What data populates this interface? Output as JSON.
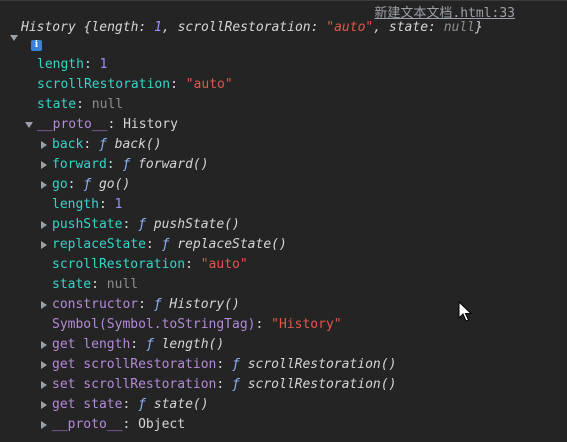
{
  "source_link": "新建文本文档.html:33",
  "header": {
    "class_name": "History",
    "open": "{",
    "k1": "length",
    "v1": "1",
    "k2": "scrollRestoration",
    "v2": "\"auto\"",
    "k3": "state",
    "v3": "null",
    "close": "}"
  },
  "info_icon_glyph": "i",
  "rows": [
    {
      "key": "length",
      "sep": ": ",
      "value": "1",
      "vtype": "num"
    },
    {
      "key": "scrollRestoration",
      "sep": ": ",
      "value": "\"auto\"",
      "vtype": "str"
    },
    {
      "key": "state",
      "sep": ": ",
      "value": "null",
      "vtype": "null"
    },
    {
      "key": "__proto__",
      "sep": ": ",
      "value": "History",
      "vtype": "obj"
    },
    {
      "key": "back",
      "sep": ": ",
      "f": "ƒ",
      "value": "back()",
      "vtype": "fn"
    },
    {
      "key": "forward",
      "sep": ": ",
      "f": "ƒ",
      "value": "forward()",
      "vtype": "fn"
    },
    {
      "key": "go",
      "sep": ": ",
      "f": "ƒ",
      "value": "go()",
      "vtype": "fn"
    },
    {
      "key": "length",
      "sep": ": ",
      "value": "1",
      "vtype": "num"
    },
    {
      "key": "pushState",
      "sep": ": ",
      "f": "ƒ",
      "value": "pushState()",
      "vtype": "fn"
    },
    {
      "key": "replaceState",
      "sep": ": ",
      "f": "ƒ",
      "value": "replaceState()",
      "vtype": "fn"
    },
    {
      "key": "scrollRestoration",
      "sep": ": ",
      "value": "\"auto\"",
      "vtype": "str"
    },
    {
      "key": "state",
      "sep": ": ",
      "value": "null",
      "vtype": "null"
    },
    {
      "key": "constructor",
      "sep": ": ",
      "f": "ƒ",
      "value": "History()",
      "vtype": "fn"
    },
    {
      "key": "Symbol(Symbol.toStringTag)",
      "sep": ": ",
      "value": "\"History\"",
      "vtype": "str"
    },
    {
      "key": "get length",
      "sep": ": ",
      "f": "ƒ",
      "value": "length()",
      "vtype": "fn"
    },
    {
      "key": "get scrollRestoration",
      "sep": ": ",
      "f": "ƒ",
      "value": "scrollRestoration()",
      "vtype": "fn"
    },
    {
      "key": "set scrollRestoration",
      "sep": ": ",
      "f": "ƒ",
      "value": "scrollRestoration()",
      "vtype": "fn"
    },
    {
      "key": "get state",
      "sep": ": ",
      "f": "ƒ",
      "value": "state()",
      "vtype": "fn"
    },
    {
      "key": "__proto__",
      "sep": ": ",
      "value": "Object",
      "vtype": "obj"
    }
  ],
  "colors": {
    "background": "#242424",
    "key_own": "#35d4c7",
    "key_inherited": "#b48ad8",
    "string": "#e0574c",
    "number": "#9a8fff",
    "null": "#8e8e8e",
    "function_f": "#8ab4f8"
  },
  "icons": {
    "expanded": "triangle-down-icon",
    "collapsed": "triangle-right-icon",
    "info": "info-icon",
    "cursor": "mouse-pointer-icon"
  }
}
